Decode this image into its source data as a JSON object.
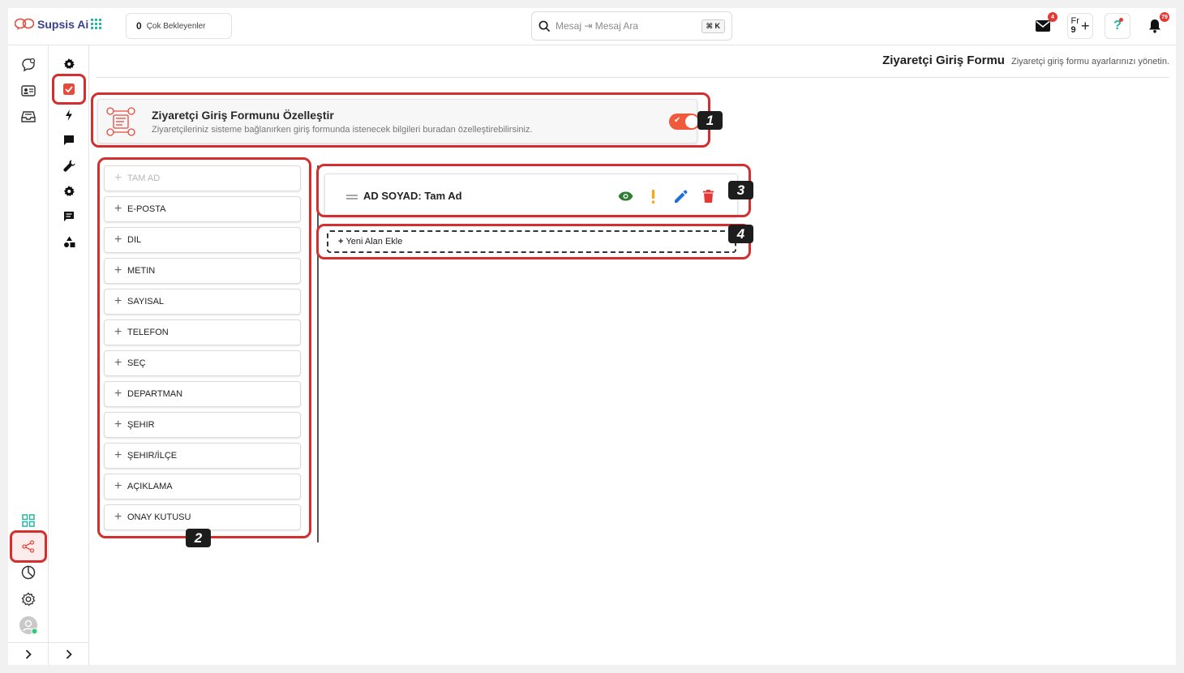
{
  "topbar": {
    "brand_name": "Supsis Ai",
    "pending_count": "0",
    "pending_label": "Çok Bekleyenler",
    "search_placeholder": "Mesaj ⇥ Mesaj Ara",
    "search_shortcut": "⌘ K",
    "mail_badge": "4",
    "fr_label": "Fr",
    "fr_count": "9",
    "notif_badge": "79",
    "help_label": "?"
  },
  "page": {
    "title": "Ziyaretçi Giriş Formu",
    "subtitle": "Ziyaretçi giriş formu ayarlarınızı yönetin."
  },
  "banner": {
    "title": "Ziyaretçi Giriş Formunu Özelleştir",
    "description": "Ziyaretçileriniz sisteme bağlanırken giriş formunda istenecek bilgileri buradan özelleştirebilirsiniz.",
    "toggle_on": true
  },
  "field_types": [
    {
      "label": "TAM AD",
      "disabled": true
    },
    {
      "label": "E-POSTA",
      "disabled": false
    },
    {
      "label": "DIL",
      "disabled": false
    },
    {
      "label": "METIN",
      "disabled": false
    },
    {
      "label": "SAYISAL",
      "disabled": false
    },
    {
      "label": "TELEFON",
      "disabled": false
    },
    {
      "label": "SEÇ",
      "disabled": false
    },
    {
      "label": "DEPARTMAN",
      "disabled": false
    },
    {
      "label": "ŞEHIR",
      "disabled": false
    },
    {
      "label": "ŞEHIR/İLÇE",
      "disabled": false
    },
    {
      "label": "AÇIKLAMA",
      "disabled": false
    },
    {
      "label": "ONAY KUTUSU",
      "disabled": false
    }
  ],
  "form_fields": [
    {
      "label": "AD SOYAD: Tam Ad"
    }
  ],
  "add_field_label": "Yeni Alan Ekle",
  "add_field_plus": "+",
  "callouts": [
    "1",
    "2",
    "3",
    "4"
  ],
  "colors": {
    "accent": "#f05a3c",
    "highlight": "#d32f2f",
    "eye": "#2e7d32",
    "required": "#f5a623",
    "edit": "#1e6fd9",
    "delete": "#e53935"
  }
}
